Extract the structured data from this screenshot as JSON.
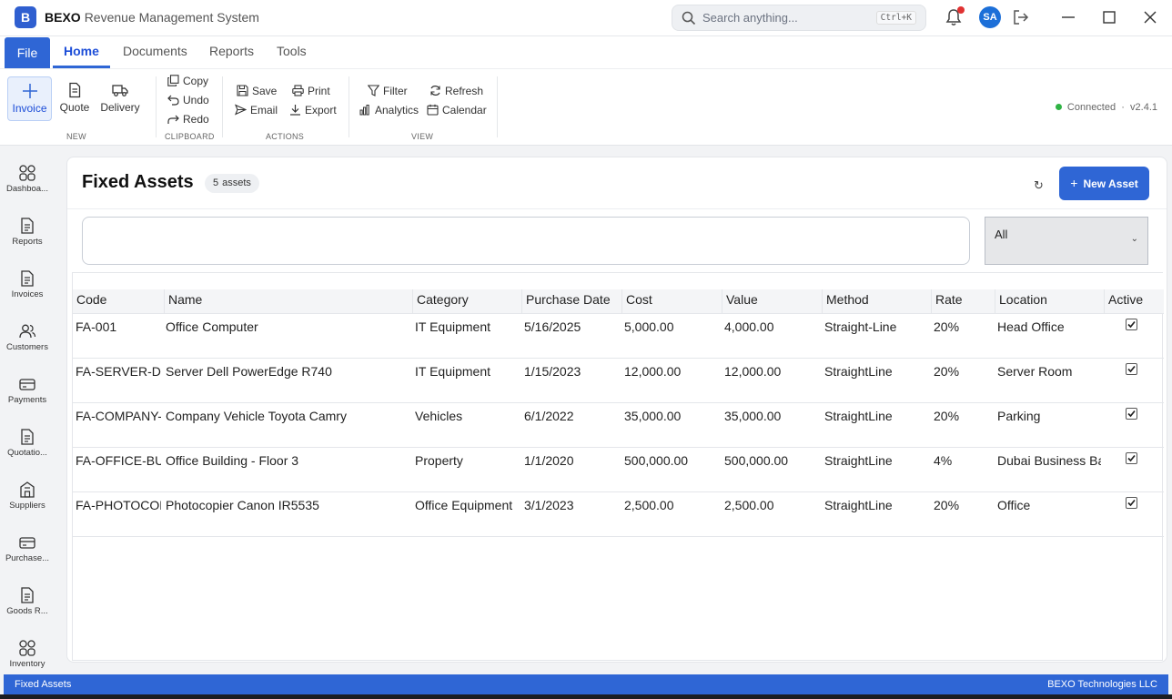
{
  "app": {
    "logo_letter": "B",
    "brand": "BEXO",
    "title": "Revenue Management System"
  },
  "search": {
    "placeholder": "Search anything...",
    "shortcut": "Ctrl+K"
  },
  "user": {
    "initials": "SA"
  },
  "menu": {
    "file": "File",
    "tabs": [
      "Home",
      "Documents",
      "Reports",
      "Tools"
    ],
    "active_tab": "Home"
  },
  "ribbon": {
    "new": {
      "label": "NEW",
      "invoice": "Invoice",
      "quote": "Quote",
      "delivery": "Delivery"
    },
    "clipboard": {
      "label": "CLIPBOARD",
      "copy": "Copy",
      "undo": "Undo",
      "redo": "Redo"
    },
    "actions": {
      "label": "ACTIONS",
      "save": "Save",
      "print": "Print",
      "email": "Email",
      "export": "Export"
    },
    "view": {
      "label": "VIEW",
      "filter": "Filter",
      "refresh": "Refresh",
      "analytics": "Analytics",
      "calendar": "Calendar"
    },
    "status": {
      "text": "Connected",
      "separator": "·",
      "version": "v2.4.1"
    }
  },
  "sidebar": {
    "items": [
      {
        "label": "Dashboa..."
      },
      {
        "label": "Reports"
      },
      {
        "label": "Invoices"
      },
      {
        "label": "Customers"
      },
      {
        "label": "Payments"
      },
      {
        "label": "Quotatio..."
      },
      {
        "label": "Suppliers"
      },
      {
        "label": "Purchase..."
      },
      {
        "label": "Goods R..."
      },
      {
        "label": "Inventory"
      }
    ]
  },
  "page": {
    "title": "Fixed Assets",
    "count": "5",
    "count_label": "assets",
    "refresh_glyph": "↻",
    "new_button": "New Asset",
    "new_button_plus": "+"
  },
  "filter": {
    "search_value": "",
    "select_value": "All"
  },
  "table": {
    "columns": [
      "Code",
      "Name",
      "Category",
      "Purchase Date",
      "Cost",
      "Value",
      "Method",
      "Rate",
      "Location",
      "Active"
    ],
    "rows": [
      {
        "code": "FA-001",
        "name": "Office Computer",
        "category": "IT Equipment",
        "date": "5/16/2025",
        "cost": "5,000.00",
        "value": "4,000.00",
        "method": "Straight-Line",
        "rate": "20%",
        "location": "Head Office",
        "active": true
      },
      {
        "code": "FA-SERVER-DELL",
        "name": "Server Dell PowerEdge R740",
        "category": "IT Equipment",
        "date": "1/15/2023",
        "cost": "12,000.00",
        "value": "12,000.00",
        "method": "StraightLine",
        "rate": "20%",
        "location": "Server Room",
        "active": true
      },
      {
        "code": "FA-COMPANY-VEHICLE",
        "name": "Company Vehicle Toyota Camry",
        "category": "Vehicles",
        "date": "6/1/2022",
        "cost": "35,000.00",
        "value": "35,000.00",
        "method": "StraightLine",
        "rate": "20%",
        "location": "Parking",
        "active": true
      },
      {
        "code": "FA-OFFICE-BUILDING",
        "name": "Office Building - Floor 3",
        "category": "Property",
        "date": "1/1/2020",
        "cost": "500,000.00",
        "value": "500,000.00",
        "method": "StraightLine",
        "rate": "4%",
        "location": "Dubai Business Bay",
        "active": true
      },
      {
        "code": "FA-PHOTOCOPIER",
        "name": "Photocopier Canon IR5535",
        "category": "Office Equipment",
        "date": "3/1/2023",
        "cost": "2,500.00",
        "value": "2,500.00",
        "method": "StraightLine",
        "rate": "20%",
        "location": "Office",
        "active": true
      }
    ]
  },
  "statusbar": {
    "left": "Fixed Assets",
    "right": "BEXO Technologies LLC"
  },
  "colors": {
    "accent": "#2f66d5",
    "notification": "#e03131",
    "connected": "#2fb344"
  }
}
